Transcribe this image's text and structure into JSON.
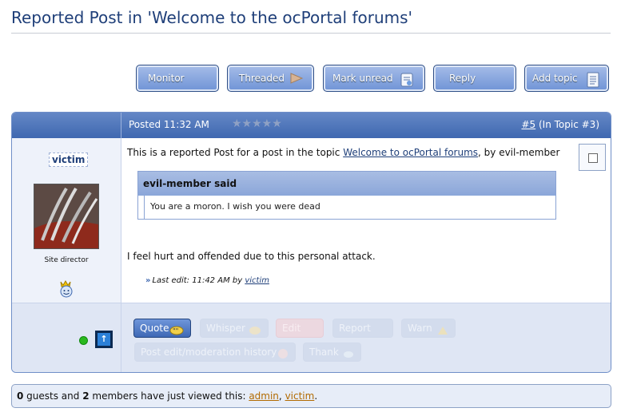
{
  "page": {
    "title": "Reported Post in 'Welcome to the ocPortal forums'"
  },
  "topic_buttons": {
    "monitor": "Monitor",
    "threaded": "Threaded",
    "mark_unread": "Mark unread",
    "reply": "Reply",
    "add_topic": "Add topic"
  },
  "post": {
    "posted": "Posted 11:32 AM",
    "stars": "★★★★★",
    "number": "#5",
    "in_topic": " (In Topic #3)",
    "username": "victim",
    "user_title": "Site director",
    "intro_prefix": "This is a reported Post for a post in the topic ",
    "intro_link": "Welcome to ocPortal forums",
    "intro_suffix": ", by evil-member",
    "quote_author": "evil-member said",
    "quote_text": "You are a moron. I wish you were dead",
    "body": "I feel hurt and offended due to this personal attack.",
    "last_edit_prefix": "Last edit: 11:42 AM by ",
    "last_edit_user": "victim"
  },
  "post_actions": {
    "quote": "Quote",
    "whisper": "Whisper",
    "edit": "Edit",
    "report": "Report",
    "warn": "Warn",
    "history": "Post edit/moderation history",
    "thank": "Thank"
  },
  "viewers": {
    "guests": "0",
    "text1": " guests and ",
    "members": "2",
    "text2": " members have just viewed this: ",
    "member1": "admin",
    "sep": ", ",
    "member2": "victim",
    "end": "."
  },
  "colors": {
    "accent": "#3f68b0",
    "title": "#1f3f79",
    "online": "#29b81f",
    "link_viewers": "#b26a00"
  }
}
